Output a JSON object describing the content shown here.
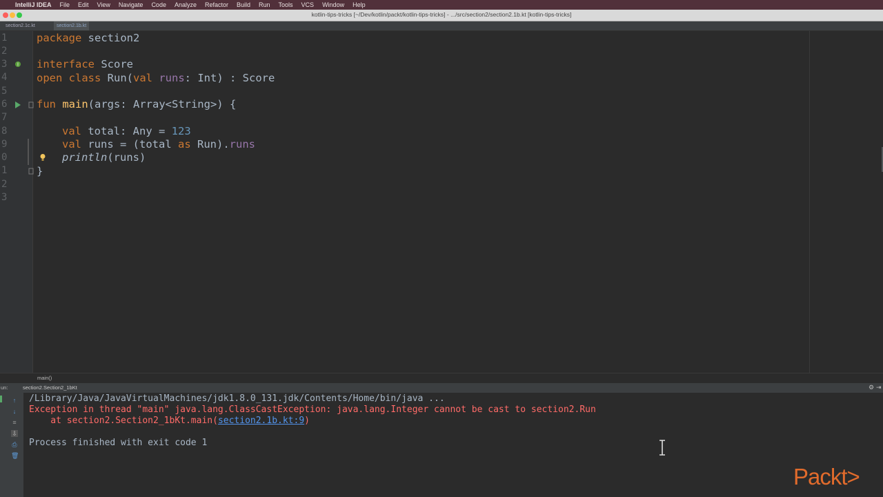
{
  "menubar": {
    "app": "IntelliJ IDEA",
    "items": [
      "File",
      "Edit",
      "View",
      "Navigate",
      "Code",
      "Analyze",
      "Refactor",
      "Build",
      "Run",
      "Tools",
      "VCS",
      "Window",
      "Help"
    ]
  },
  "window": {
    "title": "kotlin-tips-tricks [~/Dev/kotlin/packt/kotlin-tips-tricks] - .../src/section2/section2.1b.kt [kotlin-tips-tricks]"
  },
  "tabs": [
    {
      "label": "section2.1c.kt"
    },
    {
      "label": "section2.1b.kt"
    }
  ],
  "editor": {
    "line_numbers": [
      "1",
      "2",
      "3",
      "4",
      "5",
      "6",
      "7",
      "8",
      "9",
      "0",
      "1",
      "2",
      "3"
    ],
    "lines": {
      "l1": {
        "a": "package",
        "b": " section2"
      },
      "l3": {
        "a": "interface",
        "b": " Score"
      },
      "l4": {
        "a": "open class",
        "b": " Run(",
        "c": "val",
        "d": " runs",
        "e": ": Int) : Score"
      },
      "l6": {
        "a": "fun",
        "b": " ",
        "c": "main",
        "d": "(args: Array<String>) {"
      },
      "l8": {
        "a": "val",
        "b": " total: Any = ",
        "c": "123"
      },
      "l9": {
        "a": "val",
        "b": " runs = (total ",
        "c": "as",
        "d": " Run).",
        "e": "runs"
      },
      "l10": {
        "a": "println",
        "b": "(runs)"
      },
      "l11": {
        "a": "}"
      }
    }
  },
  "breadcrumb": "main()",
  "run": {
    "label": "un:",
    "config": "section2.Section2_1bKt",
    "console": {
      "cmd": "/Library/Java/JavaVirtualMachines/jdk1.8.0_131.jdk/Contents/Home/bin/java ...",
      "err1": "Exception in thread \"main\" java.lang.ClassCastException: java.lang.Integer cannot be cast to section2.Run",
      "err2_prefix": "    at section2.Section2_1bKt.main(",
      "err2_link": "section2.1b.kt:9",
      "err2_suffix": ")",
      "exit": "Process finished with exit code 1"
    }
  },
  "watermark": "Packt>",
  "colors": {
    "keyword": "#cc7832",
    "function": "#ffc66d",
    "property": "#9876aa",
    "number": "#6897bb",
    "error": "#ff6b68",
    "link": "#5394ec"
  }
}
